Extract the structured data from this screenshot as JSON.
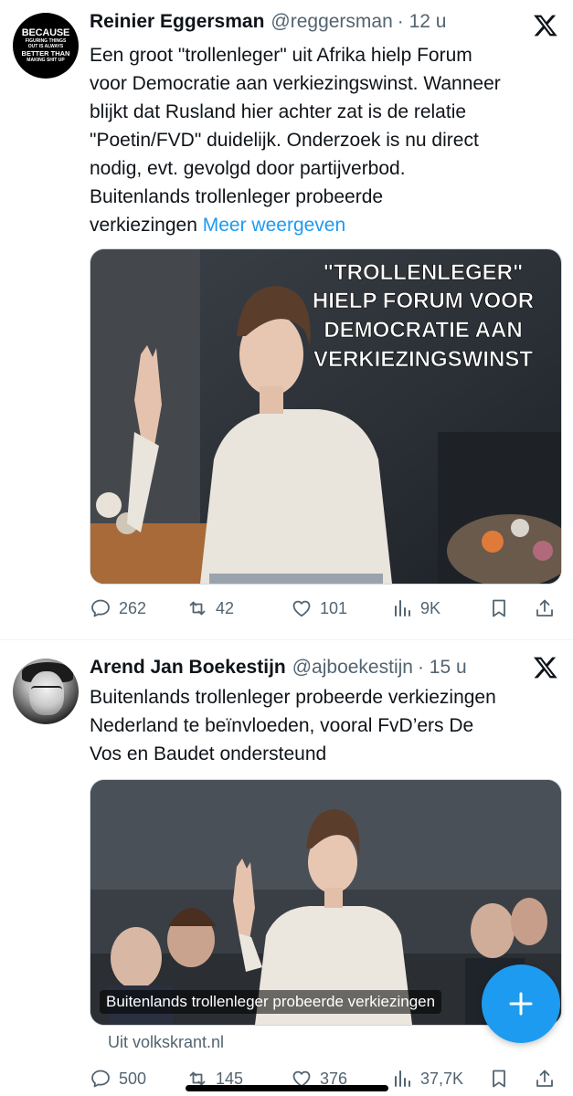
{
  "tweets": [
    {
      "avatar_text": [
        "BECAUSE",
        "FIGURING THINGS",
        "OUT IS ALWAYS",
        "BETTER THAN",
        "MAKING SHIT UP"
      ],
      "name": "Reinier Eggersman",
      "handle": "@reggersman",
      "time": "· 12 u",
      "lines": [
        "Een groot \"trollenleger\" uit Afrika hielp Forum",
        "voor Democratie aan verkiezingswinst. Wanneer",
        "blijkt dat Rusland hier achter zat is de relatie",
        "\"Poetin/FVD\" duidelijk. Onderzoek is nu direct",
        "nodig, evt. gevolgd door partijverbod.",
        "Buitenlands trollenleger probeerde"
      ],
      "last_line": "verkiezingen",
      "more_label": "Meer weergeven",
      "media_overlay": [
        "\"TROLLENLEGER\"",
        "HIELP FORUM VOOR",
        "DEMOCRATIE AAN",
        "VERKIEZINGSWINST"
      ],
      "stats": {
        "replies": "262",
        "retweets": "42",
        "likes": "101",
        "views": "9K"
      }
    },
    {
      "name": "Arend Jan Boekestijn",
      "handle": "@ajboekestijn",
      "time": "· 15 u",
      "lines": [
        "Buitenlands trollenleger probeerde verkiezingen",
        "Nederland te beïnvloeden, vooral FvD’ers De",
        "Vos en Baudet ondersteund"
      ],
      "card_caption": "Buitenlands trollenleger probeerde verkiezingen",
      "card_source": "Uit volkskrant.nl",
      "stats": {
        "replies": "500",
        "retweets": "145",
        "likes": "376",
        "views": "37,7K"
      }
    }
  ],
  "colors": {
    "accent": "#1d9bf0",
    "text": "#0f1419",
    "muted": "#536471"
  },
  "icons": [
    "x-logo-icon",
    "reply-icon",
    "retweet-icon",
    "like-icon",
    "views-icon",
    "bookmark-icon",
    "share-icon",
    "compose-plus-icon"
  ]
}
